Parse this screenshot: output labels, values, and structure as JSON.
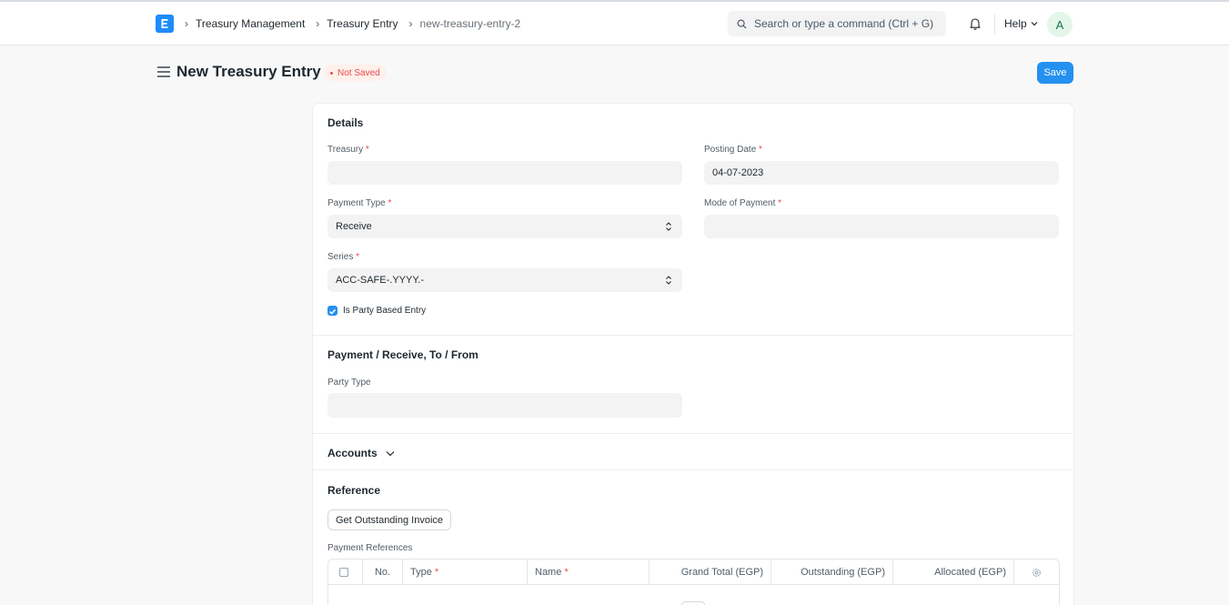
{
  "navbar": {
    "breadcrumbs": [
      "Treasury Management",
      "Treasury Entry",
      "new-treasury-entry-2"
    ],
    "search_placeholder": "Search or type a command (Ctrl + G)",
    "help_label": "Help",
    "avatar_initial": "A"
  },
  "page": {
    "title": "New Treasury Entry",
    "status": "Not Saved",
    "save_label": "Save"
  },
  "details": {
    "title": "Details",
    "treasury_label": "Treasury",
    "treasury_value": "",
    "posting_date_label": "Posting Date",
    "posting_date_value": "04-07-2023",
    "payment_type_label": "Payment Type",
    "payment_type_value": "Receive",
    "mode_of_payment_label": "Mode of Payment",
    "mode_of_payment_value": "",
    "series_label": "Series",
    "series_value": "ACC-SAFE-.YYYY.-",
    "is_party_based_label": "Is Party Based Entry",
    "is_party_based_checked": true
  },
  "party": {
    "title": "Payment / Receive, To / From",
    "party_type_label": "Party Type",
    "party_type_value": ""
  },
  "accounts": {
    "title": "Accounts"
  },
  "reference": {
    "title": "Reference",
    "get_outstanding_label": "Get Outstanding Invoice",
    "payment_references_label": "Payment References",
    "columns": {
      "no": "No.",
      "type": "Type",
      "name": "Name",
      "grand_total": "Grand Total (EGP)",
      "outstanding": "Outstanding (EGP)",
      "allocated": "Allocated (EGP)"
    }
  },
  "required_marker": "*",
  "colors": {
    "primary": "#2490ef",
    "logo": "#1e8cfa",
    "not_saved": "#e24c4c"
  }
}
